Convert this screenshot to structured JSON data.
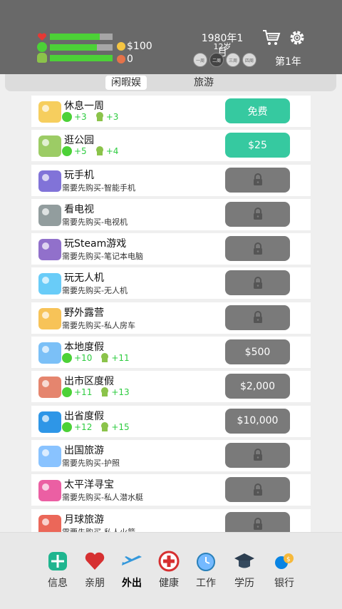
{
  "header": {
    "money": "$100",
    "karma": "0",
    "date": "1980年1月",
    "age": "12岁",
    "weeks": [
      "一周",
      "二周",
      "三周",
      "四周"
    ],
    "active_week": 1,
    "year": "第1年",
    "bars": {
      "health": 0.8,
      "happiness": 0.75,
      "smarts": 1.0
    }
  },
  "tabs": [
    "闲暇娱",
    "旅游"
  ],
  "items": [
    {
      "title": "休息一周",
      "stat1": "+3",
      "stat2": "+3",
      "button": "免费",
      "btn_style": "green"
    },
    {
      "title": "逛公园",
      "stat1": "+5",
      "stat2": "+4",
      "button": "$25",
      "btn_style": "green"
    },
    {
      "title": "玩手机",
      "sub": "需要先购买-智能手机",
      "button": "",
      "btn_style": "locked"
    },
    {
      "title": "看电视",
      "sub": "需要先购买-电视机",
      "button": "",
      "btn_style": "locked"
    },
    {
      "title": "玩Steam游戏",
      "sub": "需要先购买-笔记本电脑",
      "button": "",
      "btn_style": "locked"
    },
    {
      "title": "玩无人机",
      "sub": "需要先购买-无人机",
      "button": "",
      "btn_style": "locked"
    },
    {
      "title": "野外露营",
      "sub": "需要先购买-私人房车",
      "button": "",
      "btn_style": "locked"
    },
    {
      "title": "本地度假",
      "stat1": "+10",
      "stat2": "+11",
      "button": "$500",
      "btn_style": "gray"
    },
    {
      "title": "出市区度假",
      "stat1": "+11",
      "stat2": "+13",
      "button": "$2,000",
      "btn_style": "gray"
    },
    {
      "title": "出省度假",
      "stat1": "+12",
      "stat2": "+15",
      "button": "$10,000",
      "btn_style": "gray"
    },
    {
      "title": "出国旅游",
      "sub": "需要先购买-护照",
      "button": "",
      "btn_style": "locked"
    },
    {
      "title": "太平洋寻宝",
      "sub": "需要先购买-私人潜水艇",
      "button": "",
      "btn_style": "locked"
    },
    {
      "title": "月球旅游",
      "sub": "需要先购买-私人火箭",
      "button": "",
      "btn_style": "locked"
    }
  ],
  "nav": [
    {
      "label": "信息",
      "icon": "info-icon"
    },
    {
      "label": "亲朋",
      "icon": "heart-icon"
    },
    {
      "label": "外出",
      "icon": "plane-icon"
    },
    {
      "label": "健康",
      "icon": "health-icon"
    },
    {
      "label": "工作",
      "icon": "clock-icon"
    },
    {
      "label": "学历",
      "icon": "graduation-icon"
    },
    {
      "label": "银行",
      "icon": "bank-icon"
    }
  ],
  "nav_active": 2,
  "colors": {
    "green_btn": "#36c9a0",
    "gray_btn": "#7a7a7a",
    "header_bg": "#696969",
    "bar_fill": "#4cd137"
  }
}
